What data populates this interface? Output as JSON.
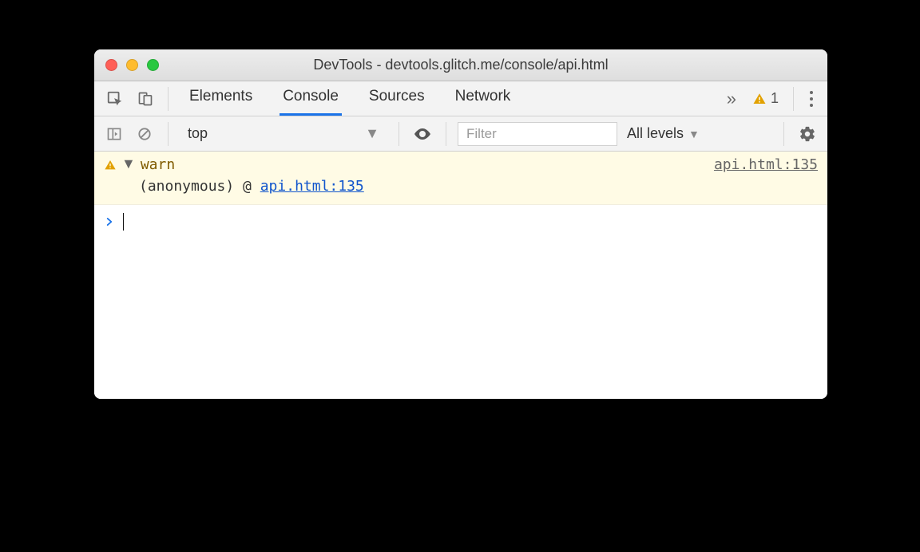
{
  "window": {
    "title": "DevTools - devtools.glitch.me/console/api.html"
  },
  "tabs": {
    "elements": "Elements",
    "console": "Console",
    "sources": "Sources",
    "network": "Network",
    "active": "Console"
  },
  "warn_badge": {
    "count": "1"
  },
  "filter": {
    "context": "top",
    "placeholder": "Filter",
    "levels_label": "All levels"
  },
  "console": {
    "warn_label": "warn",
    "warn_src": "api.html:135",
    "anon_text": "(anonymous) @ ",
    "anon_link": "api.html:135"
  }
}
